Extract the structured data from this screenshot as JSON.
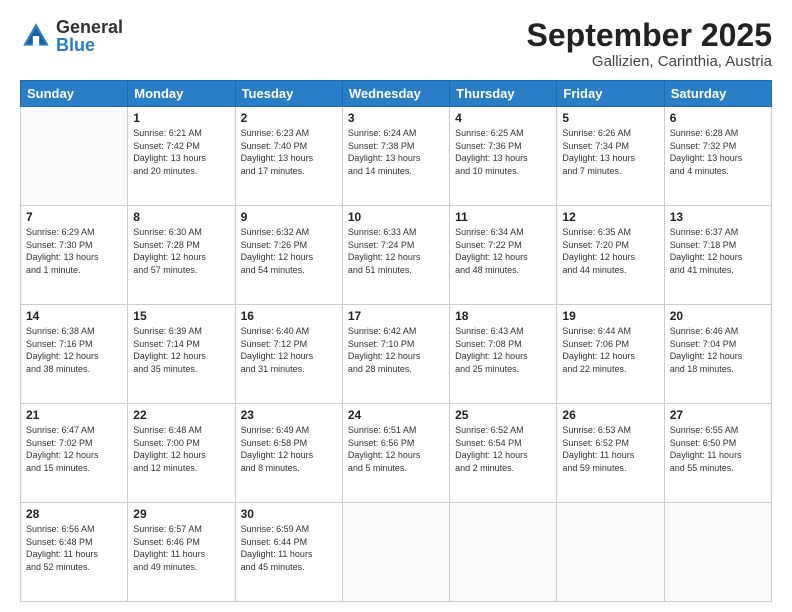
{
  "logo": {
    "general": "General",
    "blue": "Blue"
  },
  "header": {
    "month": "September 2025",
    "location": "Gallizien, Carinthia, Austria"
  },
  "weekdays": [
    "Sunday",
    "Monday",
    "Tuesday",
    "Wednesday",
    "Thursday",
    "Friday",
    "Saturday"
  ],
  "weeks": [
    [
      {
        "day": "",
        "info": ""
      },
      {
        "day": "1",
        "info": "Sunrise: 6:21 AM\nSunset: 7:42 PM\nDaylight: 13 hours\nand 20 minutes."
      },
      {
        "day": "2",
        "info": "Sunrise: 6:23 AM\nSunset: 7:40 PM\nDaylight: 13 hours\nand 17 minutes."
      },
      {
        "day": "3",
        "info": "Sunrise: 6:24 AM\nSunset: 7:38 PM\nDaylight: 13 hours\nand 14 minutes."
      },
      {
        "day": "4",
        "info": "Sunrise: 6:25 AM\nSunset: 7:36 PM\nDaylight: 13 hours\nand 10 minutes."
      },
      {
        "day": "5",
        "info": "Sunrise: 6:26 AM\nSunset: 7:34 PM\nDaylight: 13 hours\nand 7 minutes."
      },
      {
        "day": "6",
        "info": "Sunrise: 6:28 AM\nSunset: 7:32 PM\nDaylight: 13 hours\nand 4 minutes."
      }
    ],
    [
      {
        "day": "7",
        "info": "Sunrise: 6:29 AM\nSunset: 7:30 PM\nDaylight: 13 hours\nand 1 minute."
      },
      {
        "day": "8",
        "info": "Sunrise: 6:30 AM\nSunset: 7:28 PM\nDaylight: 12 hours\nand 57 minutes."
      },
      {
        "day": "9",
        "info": "Sunrise: 6:32 AM\nSunset: 7:26 PM\nDaylight: 12 hours\nand 54 minutes."
      },
      {
        "day": "10",
        "info": "Sunrise: 6:33 AM\nSunset: 7:24 PM\nDaylight: 12 hours\nand 51 minutes."
      },
      {
        "day": "11",
        "info": "Sunrise: 6:34 AM\nSunset: 7:22 PM\nDaylight: 12 hours\nand 48 minutes."
      },
      {
        "day": "12",
        "info": "Sunrise: 6:35 AM\nSunset: 7:20 PM\nDaylight: 12 hours\nand 44 minutes."
      },
      {
        "day": "13",
        "info": "Sunrise: 6:37 AM\nSunset: 7:18 PM\nDaylight: 12 hours\nand 41 minutes."
      }
    ],
    [
      {
        "day": "14",
        "info": "Sunrise: 6:38 AM\nSunset: 7:16 PM\nDaylight: 12 hours\nand 38 minutes."
      },
      {
        "day": "15",
        "info": "Sunrise: 6:39 AM\nSunset: 7:14 PM\nDaylight: 12 hours\nand 35 minutes."
      },
      {
        "day": "16",
        "info": "Sunrise: 6:40 AM\nSunset: 7:12 PM\nDaylight: 12 hours\nand 31 minutes."
      },
      {
        "day": "17",
        "info": "Sunrise: 6:42 AM\nSunset: 7:10 PM\nDaylight: 12 hours\nand 28 minutes."
      },
      {
        "day": "18",
        "info": "Sunrise: 6:43 AM\nSunset: 7:08 PM\nDaylight: 12 hours\nand 25 minutes."
      },
      {
        "day": "19",
        "info": "Sunrise: 6:44 AM\nSunset: 7:06 PM\nDaylight: 12 hours\nand 22 minutes."
      },
      {
        "day": "20",
        "info": "Sunrise: 6:46 AM\nSunset: 7:04 PM\nDaylight: 12 hours\nand 18 minutes."
      }
    ],
    [
      {
        "day": "21",
        "info": "Sunrise: 6:47 AM\nSunset: 7:02 PM\nDaylight: 12 hours\nand 15 minutes."
      },
      {
        "day": "22",
        "info": "Sunrise: 6:48 AM\nSunset: 7:00 PM\nDaylight: 12 hours\nand 12 minutes."
      },
      {
        "day": "23",
        "info": "Sunrise: 6:49 AM\nSunset: 6:58 PM\nDaylight: 12 hours\nand 8 minutes."
      },
      {
        "day": "24",
        "info": "Sunrise: 6:51 AM\nSunset: 6:56 PM\nDaylight: 12 hours\nand 5 minutes."
      },
      {
        "day": "25",
        "info": "Sunrise: 6:52 AM\nSunset: 6:54 PM\nDaylight: 12 hours\nand 2 minutes."
      },
      {
        "day": "26",
        "info": "Sunrise: 6:53 AM\nSunset: 6:52 PM\nDaylight: 11 hours\nand 59 minutes."
      },
      {
        "day": "27",
        "info": "Sunrise: 6:55 AM\nSunset: 6:50 PM\nDaylight: 11 hours\nand 55 minutes."
      }
    ],
    [
      {
        "day": "28",
        "info": "Sunrise: 6:56 AM\nSunset: 6:48 PM\nDaylight: 11 hours\nand 52 minutes."
      },
      {
        "day": "29",
        "info": "Sunrise: 6:57 AM\nSunset: 6:46 PM\nDaylight: 11 hours\nand 49 minutes."
      },
      {
        "day": "30",
        "info": "Sunrise: 6:59 AM\nSunset: 6:44 PM\nDaylight: 11 hours\nand 45 minutes."
      },
      {
        "day": "",
        "info": ""
      },
      {
        "day": "",
        "info": ""
      },
      {
        "day": "",
        "info": ""
      },
      {
        "day": "",
        "info": ""
      }
    ]
  ]
}
